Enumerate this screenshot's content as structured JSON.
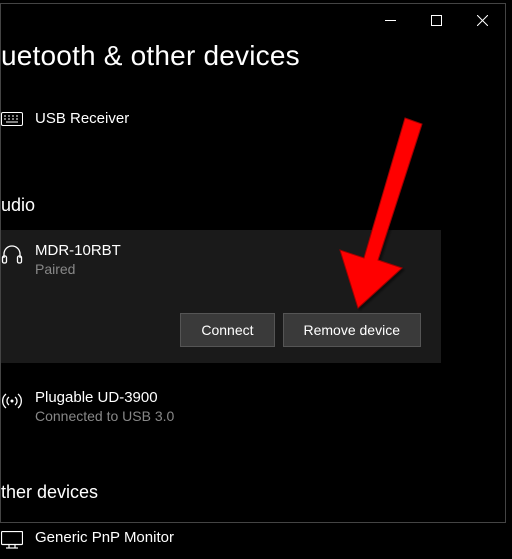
{
  "page_title": "uetooth & other devices",
  "title_bar": {
    "minimize": "minimize",
    "maximize": "maximize",
    "close": "close"
  },
  "devices": {
    "usb_receiver": {
      "name": "USB Receiver"
    }
  },
  "sections": {
    "audio": {
      "header": "udio",
      "devices": {
        "mdr_10rbt": {
          "name": "MDR-10RBT",
          "status": "Paired",
          "buttons": {
            "connect": "Connect",
            "remove": "Remove device"
          }
        },
        "plugable": {
          "name": "Plugable UD-3900",
          "status": "Connected to USB 3.0"
        }
      }
    },
    "other": {
      "header": "ther devices",
      "devices": {
        "monitor": {
          "name": "Generic PnP Monitor"
        }
      }
    }
  }
}
